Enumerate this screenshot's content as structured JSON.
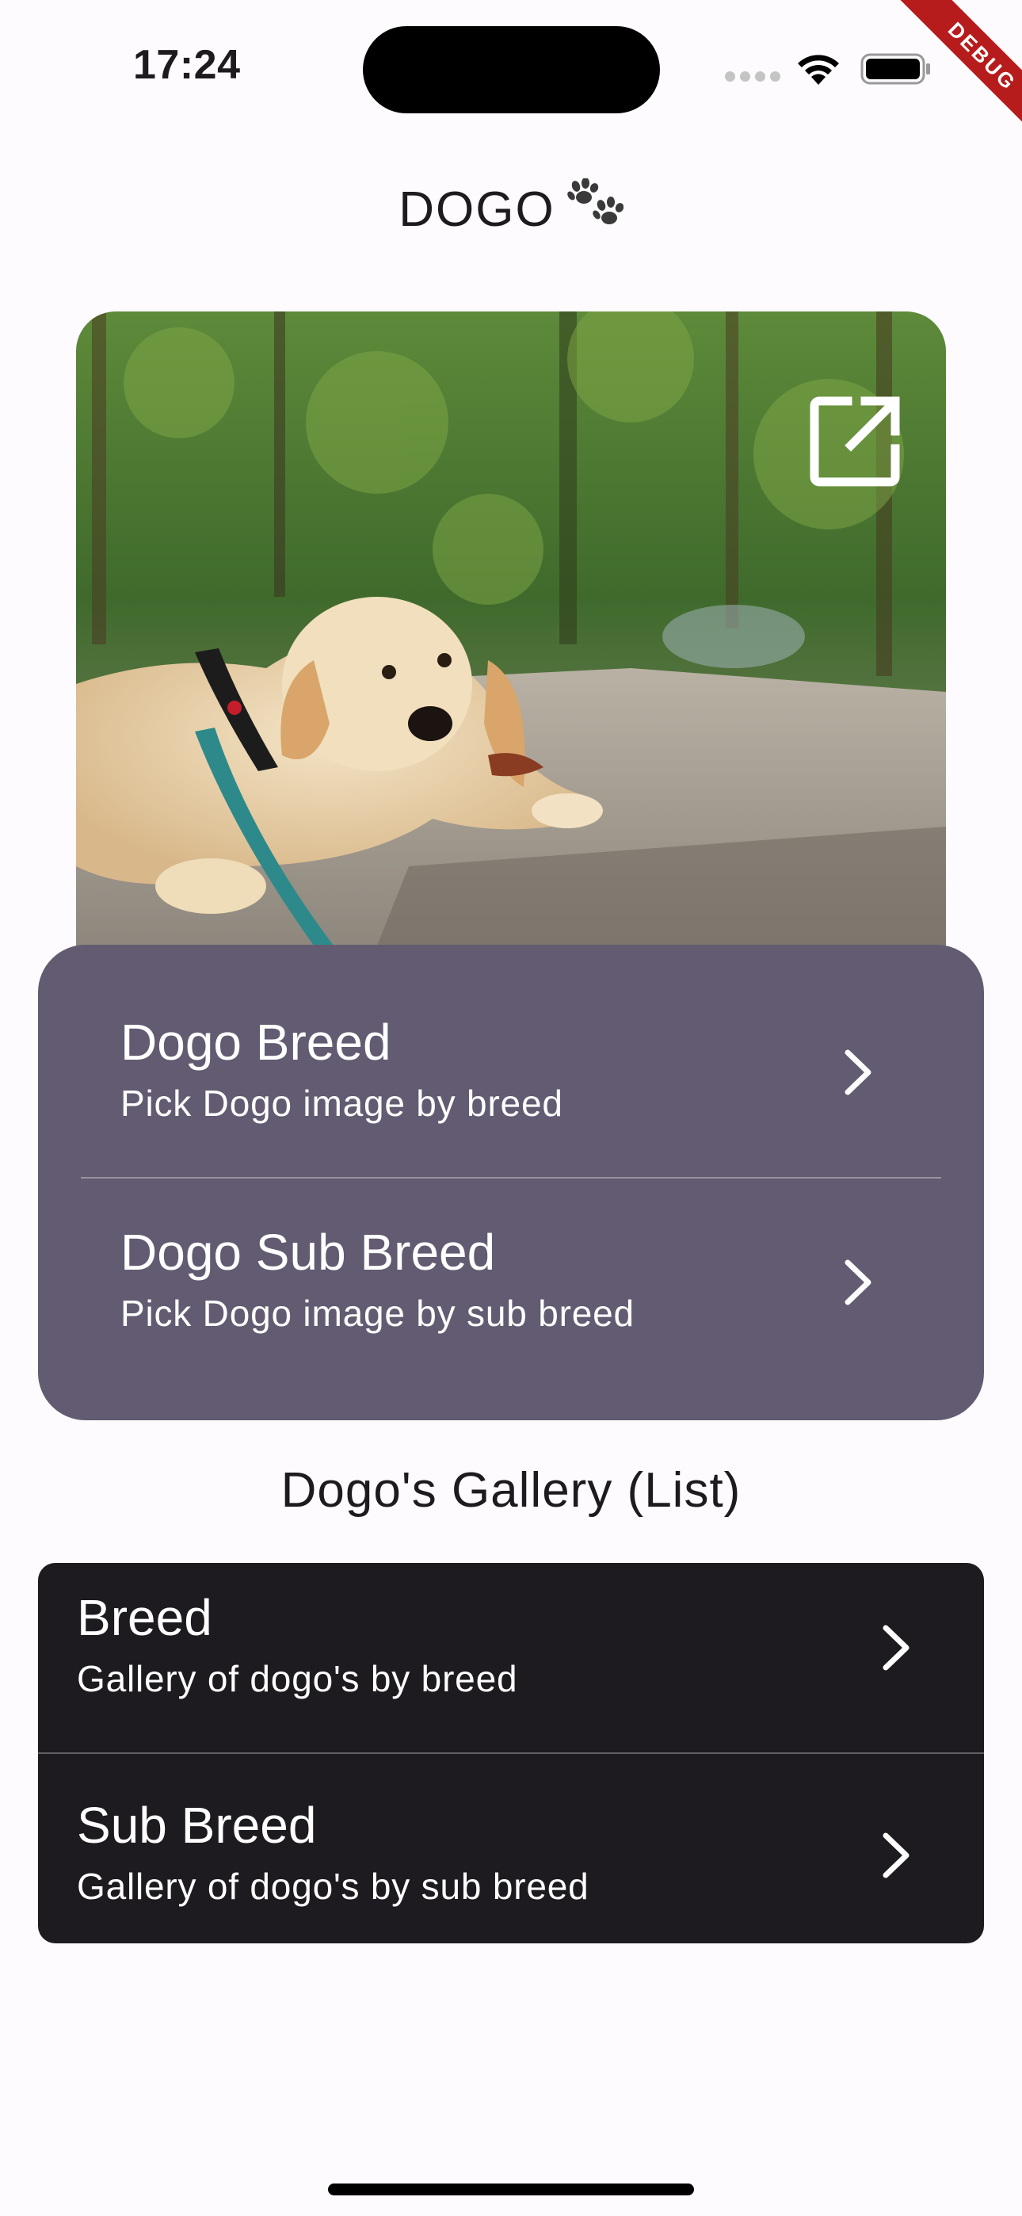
{
  "status_bar": {
    "time": "17:24",
    "icons": [
      "signal-icon",
      "wifi-icon",
      "battery-icon"
    ]
  },
  "debug_banner": "DEBUG",
  "header": {
    "title": "DOGO",
    "title_icon": "paw-prints-icon"
  },
  "hero": {
    "image_subject": "golden retriever puppy lying on rock",
    "action_icon": "open-in-new-icon"
  },
  "breed_card": {
    "color": "#625b71",
    "items": [
      {
        "title": "Dogo Breed",
        "subtitle": "Pick Dogo image by breed",
        "icon": "chevron-right-icon"
      },
      {
        "title": "Dogo Sub Breed",
        "subtitle": "Pick Dogo image by sub breed",
        "icon": "chevron-right-icon"
      }
    ]
  },
  "gallery": {
    "heading": "Dogo's Gallery (List)",
    "color": "#1d1b20",
    "items": [
      {
        "title": "Breed",
        "subtitle": "Gallery of dogo's by breed",
        "icon": "chevron-right-icon"
      },
      {
        "title": "Sub Breed",
        "subtitle": "Gallery of dogo's by sub breed",
        "icon": "chevron-right-icon"
      }
    ]
  }
}
